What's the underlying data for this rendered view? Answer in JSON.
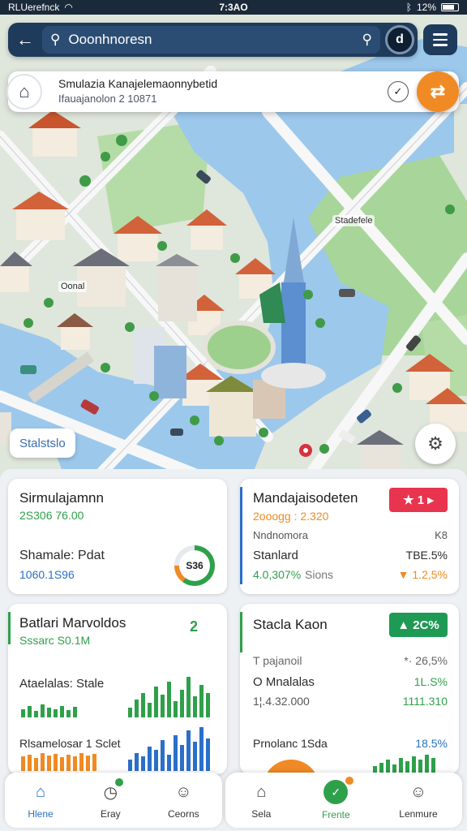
{
  "status_bar": {
    "carrier": "RLUerefnck",
    "time": "7:3AO",
    "battery": "12%"
  },
  "search": {
    "text": "Ooonhnoresn",
    "action_glyph": "d"
  },
  "info_card": {
    "title": "Smulazia Kanajelemaonnybetid",
    "subtitle": "Ifauajanolon 2 10871"
  },
  "map": {
    "labels": {
      "stadium": "Stadefele",
      "center": "Oonal"
    },
    "stats_chip": "Stalstslo"
  },
  "cards": {
    "c1": {
      "title": "Sirmulajamnn",
      "sub": "2S306 76.00",
      "label2": "Shamale: Pdat",
      "value2": "1060.1S96",
      "gauge": "S36"
    },
    "c2": {
      "title": "Mandajaisodeten",
      "badge": "★ 1 ▸",
      "sub": "2ooogg : 2.320",
      "row1_left": "Nndnomora",
      "row1_right": "K8",
      "row2_left": "Stanlard",
      "row2_right": "TBE.5%",
      "row3_left": "4.0,307%",
      "row3_mid": "Sions",
      "row3_right": "▼ 1.2,5%"
    },
    "c3": {
      "title": "Batlari Marvoldos",
      "sub": "Sssarc S0.1M",
      "side": "2",
      "label2": "Ataelalas: Stale",
      "label3": "Rlsamelosar 1 Sclet"
    },
    "c4": {
      "title": "Stacla Kaon",
      "badge": "▲ 2C%",
      "row1_left": "T pajanoil",
      "row1_right": "*· 26,5%",
      "row2_left": "O Mnalalas",
      "row2_right": "1L.S%",
      "row3_left": "1¦.4.32.000",
      "row3_right": "1111.310",
      "row4_left": "Prnolanc 1Sda",
      "row4_right": "18.5%"
    }
  },
  "nav_left": [
    {
      "label": "Hlene",
      "icon": "home-icon",
      "active": true
    },
    {
      "label": "Eray",
      "icon": "clock-icon"
    },
    {
      "label": "Ceorns",
      "icon": "user-icon"
    }
  ],
  "nav_right": [
    {
      "label": "Sela",
      "icon": "house-outline-icon"
    },
    {
      "label": "Frente",
      "icon": "leaf-icon"
    },
    {
      "label": "Lenmure",
      "icon": "person-icon"
    }
  ],
  "colors": {
    "primary": "#1f3b5c",
    "accent_orange": "#f08a24",
    "green": "#2fa04a",
    "blue": "#2a6fc9",
    "red_badge": "#e8344e"
  }
}
